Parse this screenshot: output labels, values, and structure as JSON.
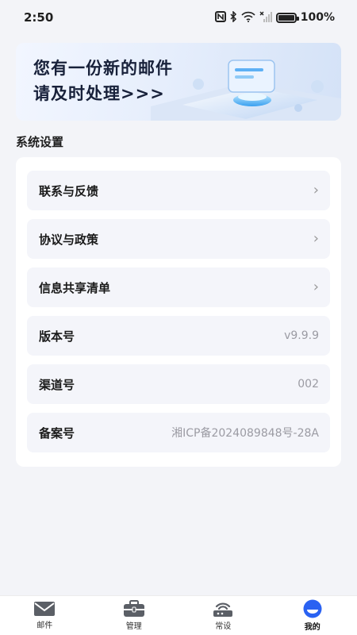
{
  "status_bar": {
    "time": "2:50",
    "battery": "100%"
  },
  "banner": {
    "line1": "您有一份新的邮件",
    "line2": "请及时处理>>>"
  },
  "section": {
    "title": "系统设置"
  },
  "settings": [
    {
      "label": "联系与反馈",
      "value": "",
      "chevron": "›"
    },
    {
      "label": "协议与政策",
      "value": "",
      "chevron": "›"
    },
    {
      "label": "信息共享清单",
      "value": "",
      "chevron": "›"
    },
    {
      "label": "版本号",
      "value": "v9.9.9",
      "chevron": ""
    },
    {
      "label": "渠道号",
      "value": "002",
      "chevron": ""
    },
    {
      "label": "备案号",
      "value": "湘ICP备2024089848号-28A",
      "chevron": ""
    }
  ],
  "tabbar": [
    {
      "label": "邮件",
      "icon": "mail-icon"
    },
    {
      "label": "管理",
      "icon": "briefcase-icon"
    },
    {
      "label": "常设",
      "icon": "router-icon"
    },
    {
      "label": "我的",
      "icon": "profile-icon",
      "active": true
    }
  ],
  "colors": {
    "background": "#f3f4f8",
    "card": "#ffffff",
    "row": "#f4f5fa",
    "accent": "#2a62f2"
  }
}
